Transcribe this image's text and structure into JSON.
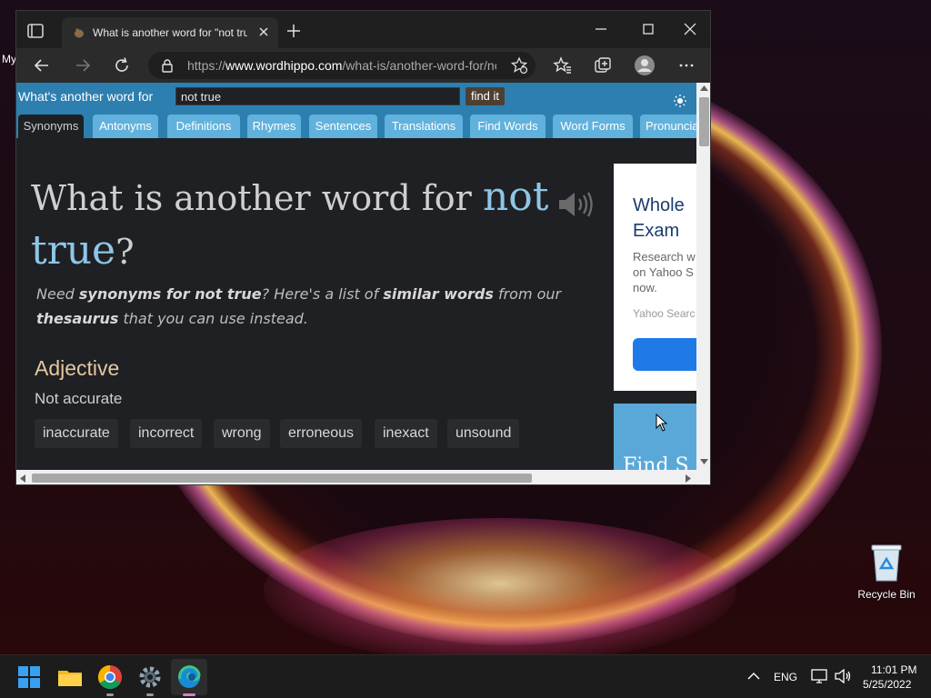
{
  "desktop": {
    "partial_label": "My",
    "recycle_bin_label": "Recycle Bin"
  },
  "browser": {
    "tab_title": "What is another word for \"not true\"",
    "url_prefix": "https://",
    "url_host": "www.wordhippo.com",
    "url_path": "/what-is/another-word-for/not_true.html"
  },
  "page": {
    "search_label": "What's another word for",
    "search_value": "not true",
    "search_button": "find it",
    "nav_tabs": [
      {
        "label": "Synonyms",
        "active": true
      },
      {
        "label": "Antonyms"
      },
      {
        "label": "Definitions"
      },
      {
        "label": "Rhymes"
      },
      {
        "label": "Sentences"
      },
      {
        "label": "Translations"
      },
      {
        "label": "Find Words"
      },
      {
        "label": "Word Forms"
      },
      {
        "label": "Pronunciation"
      }
    ],
    "heading_prefix": "What is another word for",
    "heading_word1": "not",
    "heading_word2": "true",
    "heading_suffix": "?",
    "intro": {
      "t1": "Need",
      "b1": "synonyms for not true",
      "t2": "? Here's a list of",
      "b2": "similar words",
      "t3": "from our",
      "b3": "thesaurus",
      "t4": "that you can use instead."
    },
    "part_of_speech": "Adjective",
    "sense": "Not accurate",
    "words": [
      "inaccurate",
      "incorrect",
      "wrong",
      "erroneous",
      "inexact",
      "unsound"
    ]
  },
  "ad": {
    "title": "Whole Exam",
    "text": "Research w\non Yahoo S\nnow.",
    "source": "Yahoo Searc",
    "ad2_text": "Find S"
  },
  "taskbar": {
    "language": "ENG",
    "time": "11:01 PM",
    "date": "5/25/2022"
  }
}
